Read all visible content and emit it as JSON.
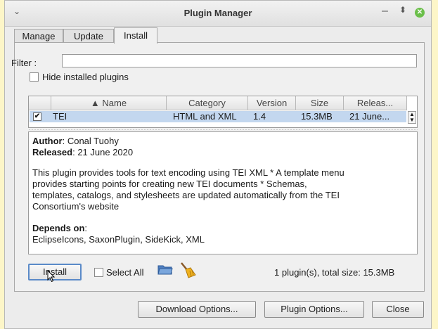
{
  "window": {
    "title": "Plugin Manager"
  },
  "tabs": [
    {
      "label": "Manage",
      "active": false
    },
    {
      "label": "Update",
      "active": false
    },
    {
      "label": "Install",
      "active": true
    }
  ],
  "filter": {
    "label": "Filter :",
    "value": ""
  },
  "hide_installed": {
    "label": "Hide installed plugins",
    "checked": false
  },
  "table": {
    "columns": [
      "▲ Name",
      "Category",
      "Version",
      "Size",
      "Releas..."
    ],
    "rows": [
      {
        "checked": true,
        "name": "TEI",
        "category": "HTML and XML",
        "version": "1.4",
        "size": "15.3MB",
        "released": "21 June..."
      }
    ]
  },
  "details": {
    "author_label": "Author",
    "author": ": Conal Tuohy",
    "released_label": "Released",
    "released": ": 21 June 2020",
    "description_lines": [
      "This plugin provides tools for text encoding using TEI XML * A template menu",
      "provides starting points for creating new TEI documents * Schemas,",
      "templates, catalogs, and stylesheets are updated automatically from the TEI",
      "Consortium's website"
    ],
    "depends_label": "Depends on",
    "depends_colon": ":",
    "depends": "EclipseIcons, SaxonPlugin, SideKick, XML"
  },
  "actions": {
    "install_label": "Install",
    "select_all_label": "Select All",
    "status": "1 plugin(s), total size: 15.3MB"
  },
  "footer": {
    "download_options": "Download Options...",
    "plugin_options": "Plugin Options...",
    "close": "Close"
  },
  "colors": {
    "selection": "#c3d7ef",
    "close_button": "#6bbf4a",
    "focus": "#5a8ac8"
  }
}
